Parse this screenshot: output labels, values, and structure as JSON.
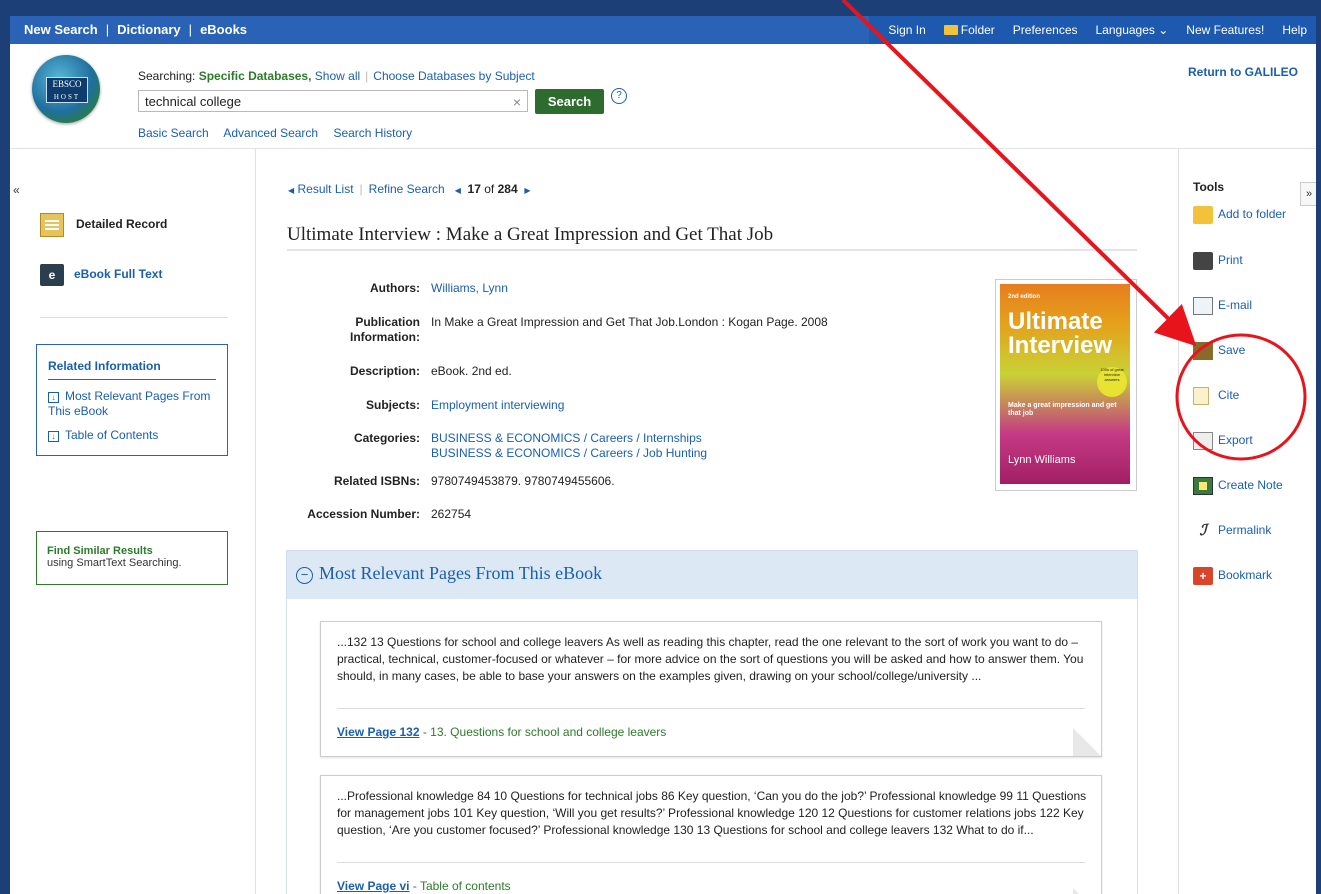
{
  "topnav": {
    "left": [
      "New Search",
      "Dictionary",
      "eBooks"
    ],
    "right": [
      "Sign In",
      "Folder",
      "Preferences",
      "Languages ⌄",
      "New Features!",
      "Help"
    ]
  },
  "header": {
    "logo_text_top": "EBSCO",
    "logo_text_bottom": "HOST",
    "searching_prefix": "Searching:",
    "searching_db": "Specific Databases,",
    "show_all": "Show all",
    "choose_db": "Choose Databases by Subject",
    "search_value": "technical college",
    "search_button": "Search",
    "help": "?",
    "links": [
      "Basic Search",
      "Advanced Search",
      "Search History"
    ],
    "return_link": "Return to GALILEO"
  },
  "leftnav": {
    "collapse": "«",
    "detailed_record": "Detailed Record",
    "ebook_icon": "e",
    "ebook_full_text": "eBook Full Text",
    "related_title": "Related Information",
    "related_items": [
      "Most Relevant Pages From This eBook",
      "Table of Contents"
    ],
    "find_similar_title": "Find Similar Results",
    "find_similar_sub": "using SmartText Searching."
  },
  "resultnav": {
    "result_list": "Result List",
    "refine_search": "Refine Search",
    "current": "17",
    "of_text": "of",
    "total": "284"
  },
  "record": {
    "title": "Ultimate Interview : Make a Great Impression and Get That Job",
    "fields": [
      {
        "label": "Authors:",
        "value": "Williams, Lynn"
      },
      {
        "label": "Publication Information:",
        "value": "In Make a Great Impression and Get That Job.London : Kogan Page. 2008"
      },
      {
        "label": "Description:",
        "value": "eBook. 2nd ed."
      },
      {
        "label": "Subjects:",
        "value": "Employment interviewing"
      },
      {
        "label": "Categories:",
        "value": "BUSINESS & ECONOMICS / Careers / Internships",
        "value2": "BUSINESS & ECONOMICS / Careers / Job Hunting"
      },
      {
        "label": "Related ISBNs:",
        "value": "9780749453879. 9780749455606."
      },
      {
        "label": "Accession Number:",
        "value": "262754"
      }
    ],
    "cover": {
      "edition": "2nd edition",
      "title": "Ultimate Interview",
      "subtitle": "Make a great impression and get that job",
      "badge": "100s of great interview answers",
      "author": "Lynn Williams"
    }
  },
  "relevant": {
    "heading": "Most Relevant Pages From This eBook",
    "cards": [
      {
        "text": "...132 13 Questions for school and college leavers As well as reading this chapter, read the one relevant to the sort of work you want to do – practical, technical, customer-focused or whatever – for more advice on the sort of questions you will be asked and how to answer them. You should, in many cases, be able to base your answers on the examples given, drawing on your school/college/university ...",
        "link": "View Page 132",
        "desc": " - 13. Questions for school and college leavers"
      },
      {
        "text": "...Professional knowledge 84 10 Questions for technical jobs 86 Key question, ‘Can you do the job?’ Professional knowledge 99 11 Questions for management jobs 101 Key question, ‘Will you get results?’ Professional knowledge 120 12 Questions for customer relations jobs 122 Key question, ‘Are you customer focused?’ Professional knowledge 130 13 Questions for school and college leavers 132 What to do if...",
        "link": "View Page vi",
        "desc": " - Table of contents"
      }
    ]
  },
  "tools": {
    "title": "Tools",
    "collapse": "»",
    "items": [
      "Add to folder",
      "Print",
      "E-mail",
      "Save",
      "Cite",
      "Export",
      "Create Note",
      "Permalink",
      "Bookmark"
    ]
  },
  "colors": {
    "nav_blue": "#2a63b5",
    "link_blue": "#1a5fae",
    "search_green": "#2e6b2e",
    "annotation_red": "#e8141b"
  }
}
